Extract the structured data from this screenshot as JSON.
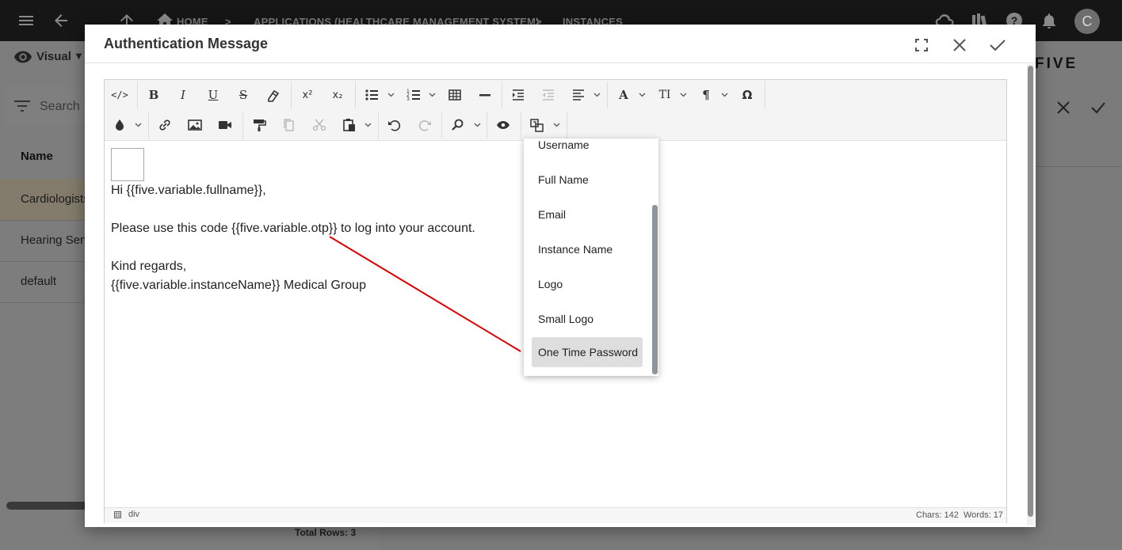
{
  "breadcrumb": {
    "home": "HOME",
    "applications": "APPLICATIONS (HEALTHCARE MANAGEMENT SYSTEM)",
    "instances": "INSTANCES"
  },
  "user": {
    "avatar_initial": "C"
  },
  "list_panel": {
    "view_mode": "Visual",
    "search_placeholder": "Search",
    "column_header": "Name",
    "rows": [
      "Cardiologists",
      "Hearing Serv",
      "default"
    ],
    "total_rows": "Total Rows: 3"
  },
  "brand": {
    "logo_text": "FIVE"
  },
  "modal": {
    "title": "Authentication Message",
    "content": {
      "greeting": "Hi {{five.variable.fullname}},",
      "body": "Please use this code {{five.variable.otp}} to log into your account.",
      "closing": "Kind regards,",
      "signature": "{{five.variable.instanceName}} Medical Group"
    },
    "status": {
      "path": "div",
      "chars": "Chars: 142",
      "words": "Words: 17"
    }
  },
  "variables_dropdown": {
    "items": [
      "Username",
      "Full Name",
      "Email",
      "Instance Name",
      "Logo",
      "Small Logo",
      "One Time Password"
    ],
    "highlighted": "One Time Password"
  },
  "toolbar": {
    "superscript": "x²",
    "subscript": "x₂",
    "font_size": "TI",
    "special_char": "Ω",
    "bold": "B",
    "italic": "I",
    "underline": "U",
    "strike": "S",
    "font_color": "A",
    "paragraph": "¶"
  },
  "colors": {
    "annotation_arrow": "#e00000",
    "dropdown_highlight": "#dedede",
    "app_bar": "#161616"
  }
}
